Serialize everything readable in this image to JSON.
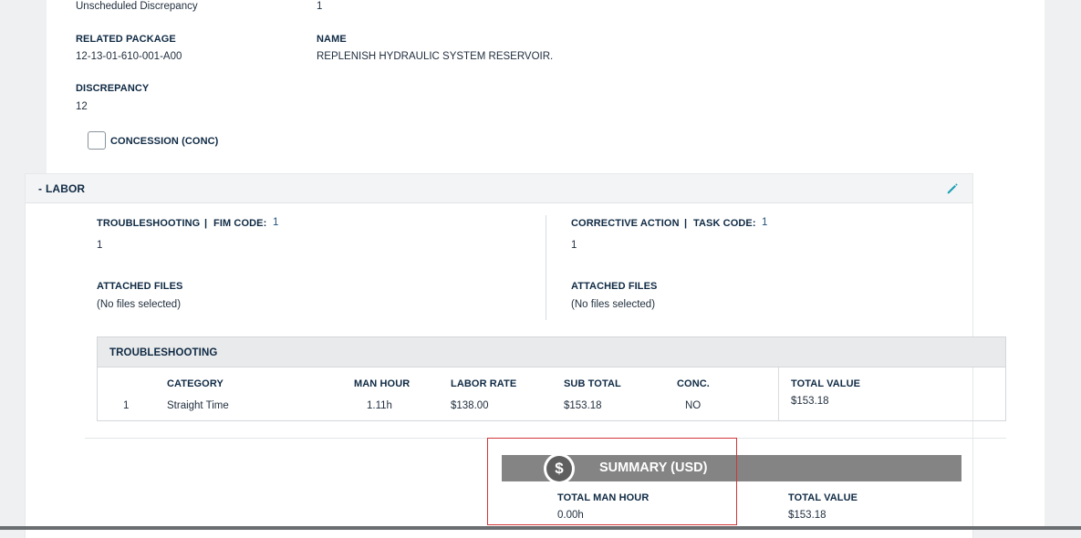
{
  "top_fields": {
    "unscheduled_label": "Unscheduled Discrepancy",
    "unscheduled_value": "1",
    "related_package_label": "RELATED PACKAGE",
    "related_package_value": "12-13-01-610-001-A00",
    "name_label": "NAME",
    "name_value": "REPLENISH HYDRAULIC SYSTEM RESERVOIR.",
    "discrepancy_label": "DISCREPANCY",
    "discrepancy_value": "12",
    "concession_label": "CONCESSION (CONC)",
    "concession_checked": false
  },
  "labor": {
    "toggle": "-",
    "title": "LABOR",
    "edit_icon": "pencil-icon",
    "troubleshooting": {
      "label": "TROUBLESHOOTING",
      "sep": "|",
      "code_label": "FIM CODE:",
      "code_value": "1",
      "text": "1",
      "files_label": "ATTACHED FILES",
      "files_value": "(No files selected)"
    },
    "corrective": {
      "label": "CORRECTIVE ACTION",
      "sep": "|",
      "code_label": "TASK CODE:",
      "code_value": "1",
      "text": "1",
      "files_label": "ATTACHED FILES",
      "files_value": "(No files selected)"
    },
    "table": {
      "title": "TROUBLESHOOTING",
      "columns": [
        "CATEGORY",
        "MAN HOUR",
        "LABOR RATE",
        "SUB TOTAL",
        "CONC."
      ],
      "rows": [
        {
          "index": "1",
          "category": "Straight Time",
          "man_hour": "1.11h",
          "labor_rate": "$138.00",
          "sub_total": "$153.18",
          "conc": "NO"
        }
      ],
      "total_label": "TOTAL VALUE",
      "total_value": "$153.18"
    }
  },
  "summary": {
    "icon": "dollar-icon",
    "icon_glyph": "$",
    "title": "SUMMARY (USD)",
    "man_hour_label": "TOTAL MAN HOUR",
    "man_hour_value": "0.00h",
    "total_label": "TOTAL VALUE",
    "total_value": "$153.18"
  },
  "colors": {
    "label": "#0f2a44",
    "summary_bar": "#848484",
    "highlight_box": "#d0363b",
    "edit_icon": "#1a9fb5"
  }
}
